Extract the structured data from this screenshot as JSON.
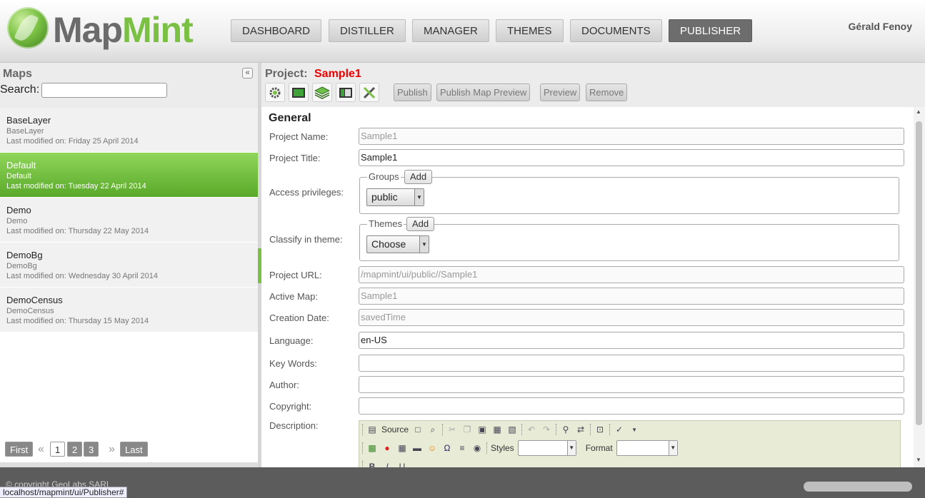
{
  "app": {
    "brand_part1": "Map",
    "brand_part2": "Mint",
    "user": "Gérald Fenoy"
  },
  "nav": [
    {
      "label": "DASHBOARD",
      "active": false
    },
    {
      "label": "DISTILLER",
      "active": false
    },
    {
      "label": "MANAGER",
      "active": false
    },
    {
      "label": "THEMES",
      "active": false
    },
    {
      "label": "DOCUMENTS",
      "active": false
    },
    {
      "label": "PUBLISHER",
      "active": true
    }
  ],
  "sidebar": {
    "title": "Maps",
    "search_label": "Search:",
    "search_value": "",
    "items": [
      {
        "name": "BaseLayer",
        "sub": "BaseLayer",
        "modified": "Last modified on: Friday 25 April 2014",
        "selected": false
      },
      {
        "name": "Default",
        "sub": "Default",
        "modified": "Last modified on: Tuesday 22 April 2014",
        "selected": true
      },
      {
        "name": "Demo",
        "sub": "Demo",
        "modified": "Last modified on: Thursday 22 May 2014",
        "selected": false
      },
      {
        "name": "DemoBg",
        "sub": "DemoBg",
        "modified": "Last modified on: Wednesday 30 April 2014",
        "selected": false
      },
      {
        "name": "DemoCensus",
        "sub": "DemoCensus",
        "modified": "Last modified on: Thursday 15 May 2014",
        "selected": false
      }
    ],
    "pager": {
      "first": "First",
      "prev": "«",
      "pages": [
        "1",
        "2",
        "3"
      ],
      "current": "1",
      "next": "»",
      "last": "Last"
    }
  },
  "project": {
    "label": "Project:",
    "name": "Sample1",
    "tools": [
      "gear-icon",
      "picture-icon",
      "layers-icon",
      "panel-icon",
      "wrench-icon"
    ],
    "actions": [
      "Publish",
      "Publish Map Preview",
      "Preview",
      "Remove"
    ]
  },
  "form": {
    "section": "General",
    "project_name_label": "Project Name:",
    "project_name_placeholder": "Sample1",
    "project_title_label": "Project Title:",
    "project_title_value": "Sample1",
    "access_label": "Access privileges:",
    "groups_legend": "Groups",
    "groups_add": "Add",
    "groups_value": "public",
    "classify_label": "Classify in theme:",
    "themes_legend": "Themes",
    "themes_add": "Add",
    "themes_value": "Choose",
    "url_label": "Project URL:",
    "url_value": "/mapmint/ui/public//Sample1",
    "active_map_label": "Active Map:",
    "active_map_value": "Sample1",
    "creation_label": "Creation Date:",
    "creation_value": "savedTime",
    "language_label": "Language:",
    "language_value": "en-US",
    "keywords_label": "Key Words:",
    "keywords_value": "",
    "author_label": "Author:",
    "author_value": "",
    "copyright_label": "Copyright:",
    "copyright_value": "",
    "description_label": "Description:"
  },
  "editor": {
    "source": "Source",
    "styles": "Styles",
    "format": "Format"
  },
  "footer": {
    "copyright": "© copyright GeoLabs SARL",
    "status_url": "localhost/mapmint/ui/Publisher#"
  }
}
